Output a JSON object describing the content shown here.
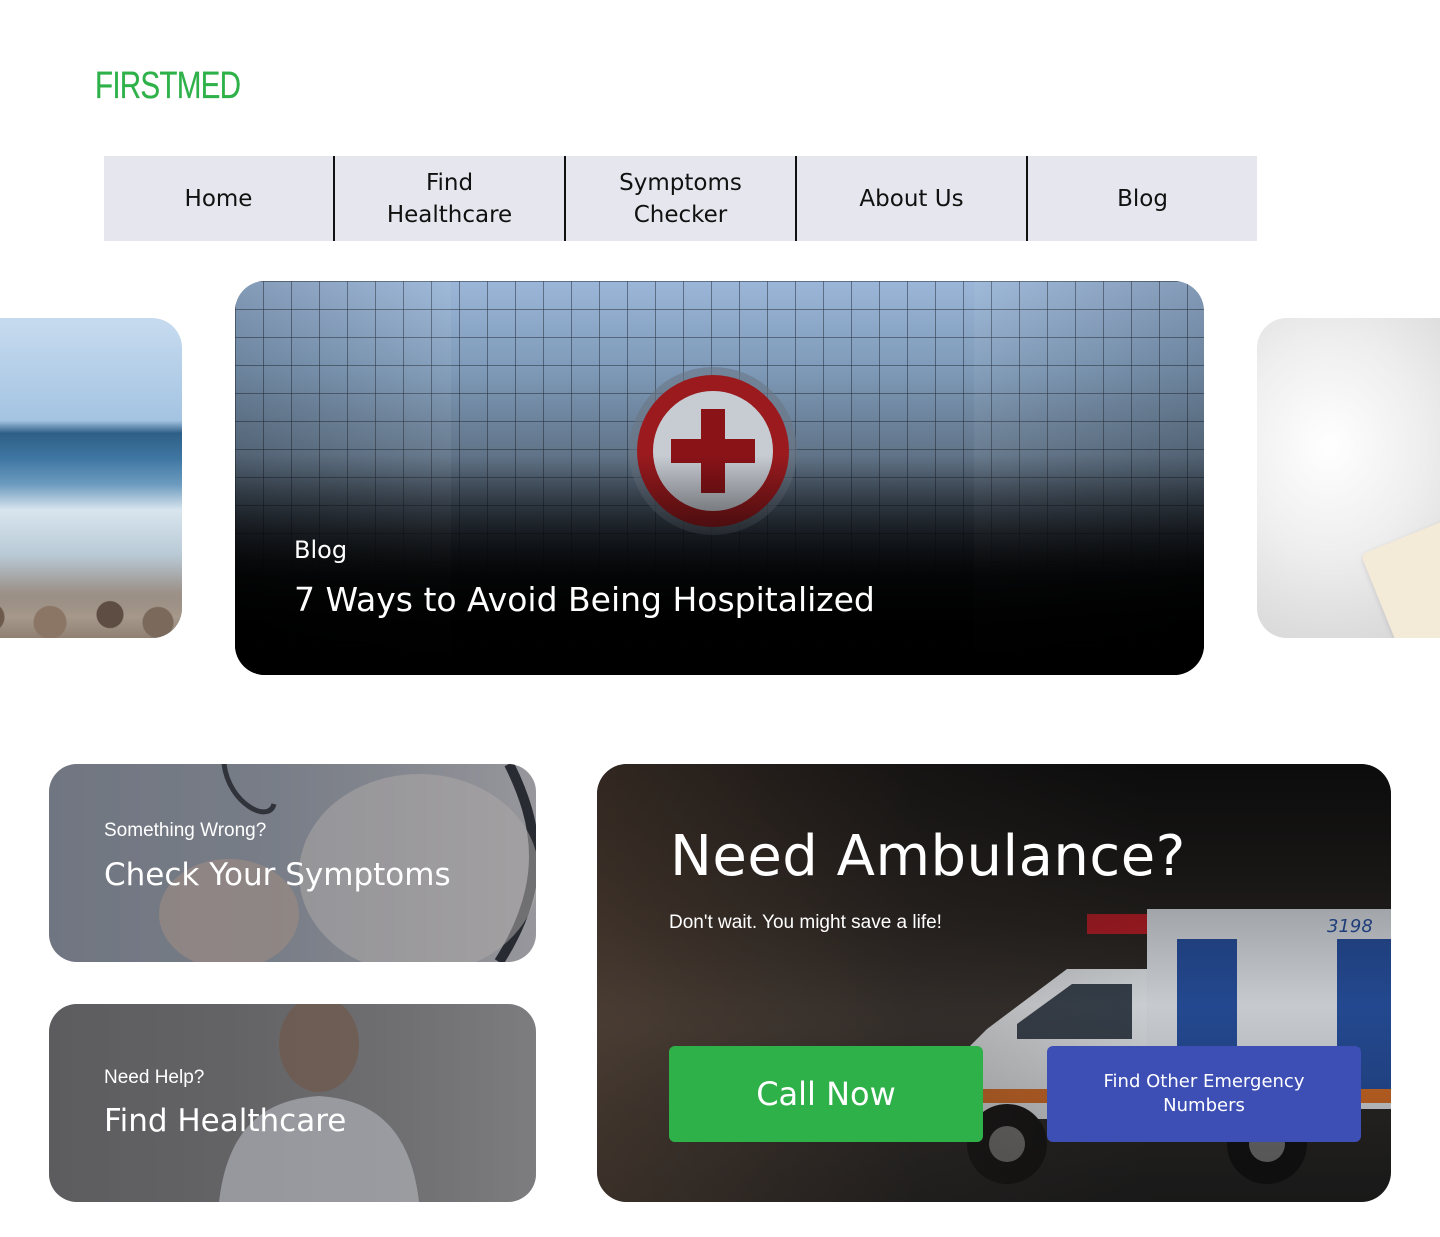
{
  "brand": {
    "logo_text": "FIRSTMED",
    "color": "#2fb14a"
  },
  "nav": {
    "items": [
      {
        "label": "Home"
      },
      {
        "label": "Find\nHealthcare"
      },
      {
        "label": "Symptoms\nChecker"
      },
      {
        "label": "About Us"
      },
      {
        "label": "Blog"
      }
    ],
    "background": "#e6e6ee"
  },
  "carousel": {
    "featured": {
      "tag": "Blog",
      "title": "7 Ways to Avoid Being Hospitalized"
    }
  },
  "cards": {
    "symptoms": {
      "kicker": "Something Wrong?",
      "title": "Check Your Symptoms"
    },
    "healthcare": {
      "kicker": "Need Help?",
      "title": "Find Healthcare"
    }
  },
  "ambulance": {
    "title": "Need Ambulance?",
    "subtitle": "Don't wait. You might save a life!",
    "call_button": "Call Now",
    "find_button": "Find Other Emergency Numbers",
    "call_color": "#2fb14a",
    "find_color": "#3d4fb5",
    "vehicle_number": "3198"
  }
}
